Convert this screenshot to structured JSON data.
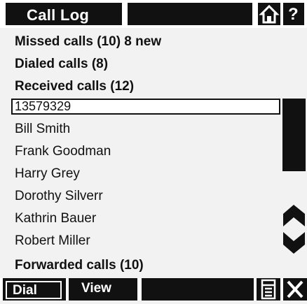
{
  "header": {
    "title": "Call Log",
    "help_label": "?"
  },
  "sections": {
    "missed": "Missed calls (10) 8 new",
    "dialed": "Dialed calls (8)",
    "received": "Received calls (12)",
    "forwarded": "Forwarded calls (10)"
  },
  "search": {
    "value": "13579329"
  },
  "contacts": [
    "Bill Smith",
    "Frank Goodman",
    "Harry Grey",
    "Dorothy Silverr",
    "Kathrin Bauer",
    "Robert Miller"
  ],
  "footer": {
    "dial_label": "Dial",
    "view_label": "View"
  },
  "icons": {
    "home": "home-icon",
    "help": "help-icon",
    "scroll_up": "scroll-up-icon",
    "scroll_down": "scroll-down-icon",
    "menu": "menu-icon",
    "close": "close-icon"
  }
}
